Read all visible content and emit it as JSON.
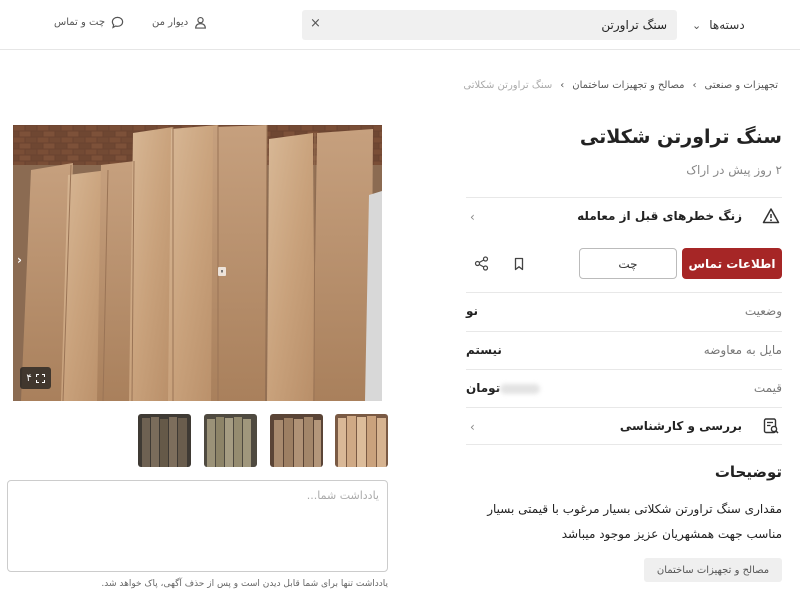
{
  "header": {
    "categories_label": "دسته‌ها",
    "search_value": "سنگ تراورتن",
    "my_wall_label": "دیوار من",
    "chat_label": "چت و تماس"
  },
  "breadcrumb": {
    "items": [
      "تجهیزات و صنعتی",
      "مصالح و تجهیزات ساختمان"
    ],
    "current": "سنگ تراورتن شکلاتی"
  },
  "ad": {
    "title": "سنگ تراورتن شکلاتی",
    "subtitle": "۲ روز پیش در اراک",
    "warning": "زنگ خطرهای قبل از معامله",
    "contact_button": "اطلاعات تماس",
    "chat_button": "چت",
    "attributes": [
      {
        "label": "وضعیت",
        "value": "نو"
      },
      {
        "label": "مایل به معاوضه",
        "value": "نیستم"
      },
      {
        "label": "قیمت",
        "value": "تومان"
      }
    ],
    "inspection": "بررسی و کارشناسی",
    "description_title": "توضیحات",
    "description": "مقداری سنگ تراورتن شکلاتی بسیار مرغوب با قیمتی بسیار مناسب جهت همشهریان عزیز موجود میباشد",
    "tag": "مصالح و تجهیزات ساختمان"
  },
  "gallery": {
    "image_count": "۴",
    "thumbnail_count": 4
  },
  "note": {
    "placeholder": "یادداشت شما...",
    "hint": "یادداشت تنها برای شما قابل دیدن است و پس از حذف آگهی، پاک خواهد شد."
  },
  "colors": {
    "primary": "#a62626",
    "muted": "#888888",
    "border": "#e8e8e8"
  },
  "icons": {
    "warning": "warning-triangle-icon",
    "bookmark": "bookmark-icon",
    "share": "share-icon",
    "inspection": "inspection-icon",
    "user": "user-icon",
    "chat": "chat-bubble-icon",
    "expand": "expand-icon"
  }
}
